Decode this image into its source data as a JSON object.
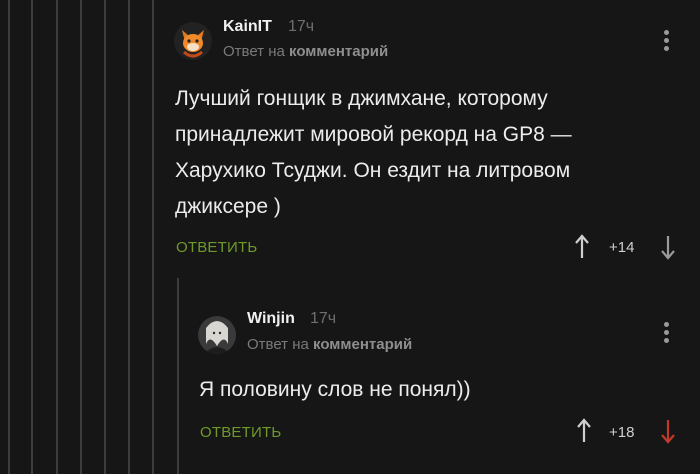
{
  "comments": [
    {
      "author": "KainIT",
      "time": "17ч",
      "reply_prefix": "Ответ на",
      "reply_link": "комментарий",
      "text_lines": [
        "Лучший гонщик в джимхане, которому",
        "принадлежит мировой рекорд на GP8 —",
        "Харухико Тсуджи. Он ездит на литровом",
        "джиксере )"
      ],
      "reply_label": "ОТВЕТИТЬ",
      "rating": "+14",
      "upvote_icon": "arrow-up-icon",
      "downvote_icon": "arrow-down-icon",
      "downvote_color": "#9a9a9a"
    },
    {
      "author": "Winjin",
      "time": "17ч",
      "reply_prefix": "Ответ на",
      "reply_link": "комментарий",
      "text_lines": [
        "Я половину слов не понял))"
      ],
      "reply_label": "ОТВЕТИТЬ",
      "rating": "+18",
      "upvote_icon": "arrow-up-icon",
      "downvote_icon": "arrow-down-icon",
      "downvote_color": "#c0392b"
    }
  ],
  "colors": {
    "background": "#161616",
    "reply_button": "#6f9a2b",
    "thread_line": "#3d3d3d",
    "downvoted_active": "#c0392b"
  }
}
